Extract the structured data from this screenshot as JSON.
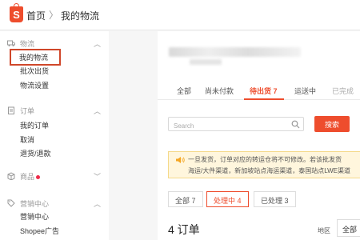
{
  "breadcrumb": {
    "home": "首页",
    "separator": "〉",
    "current": "我的物流"
  },
  "sidebar": {
    "sections": [
      {
        "title": "物流",
        "icon": "truck-icon",
        "items": [
          "我的物流",
          "批次出货",
          "物流设置"
        ]
      },
      {
        "title": "订单",
        "icon": "clipboard-icon",
        "items": [
          "我的订单",
          "取消",
          "退货/退款"
        ]
      },
      {
        "title": "商品",
        "icon": "box-icon",
        "items": []
      },
      {
        "title": "营销中心",
        "icon": "tag-icon",
        "items": [
          "营销中心",
          "Shopee广告"
        ]
      }
    ]
  },
  "status_tabs": [
    "全部",
    "尚未付款",
    "待出货 7",
    "运送中",
    "已完成"
  ],
  "search": {
    "placeholder": "Search",
    "button_label": "搜索"
  },
  "notice": {
    "line1": "一旦发货，订单对应的转运仓将不可修改。若该批发货",
    "line2": "海运/大件渠道，新加坡站点海运渠道，泰国站点LWE渠道"
  },
  "sub_tabs": [
    "全部 7",
    "处理中 4",
    "已处理 3"
  ],
  "orders_count": "4 订单",
  "filter": {
    "region_label": "地区",
    "region_value": "全部"
  },
  "colors": {
    "accent": "#ee4d2d",
    "notice_bg": "#fff6dd"
  }
}
